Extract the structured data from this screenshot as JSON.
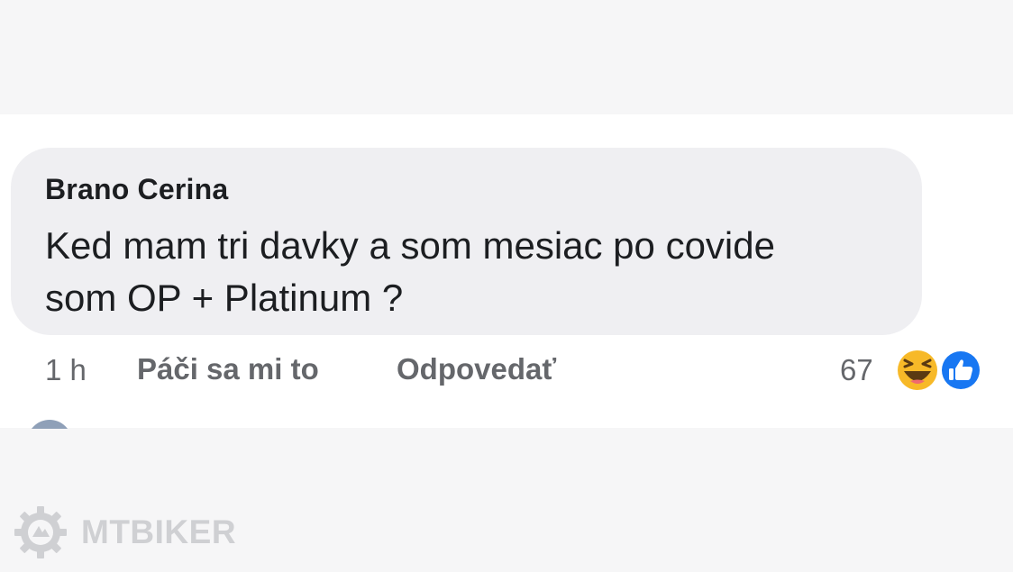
{
  "comment": {
    "author": "Brano Cerina",
    "text": "Ked mam tri davky a som mesiac po covide\nsom OP + Platinum ?"
  },
  "actions": {
    "time": "1 h",
    "like_label": "Páči sa mi to",
    "reply_label": "Odpovedať"
  },
  "reactions": {
    "count": "67",
    "icons": [
      "haha-icon",
      "like-icon"
    ]
  },
  "watermark": {
    "text": "MTBIKER",
    "icon": "gear-logo-icon"
  },
  "colors": {
    "bubble": "#efeff2",
    "text_primary": "#1c1e21",
    "text_secondary": "#65676b",
    "like_blue": "#1877f2",
    "haha_yellow": "#f7b928",
    "watermark": "#cfd0d3"
  }
}
